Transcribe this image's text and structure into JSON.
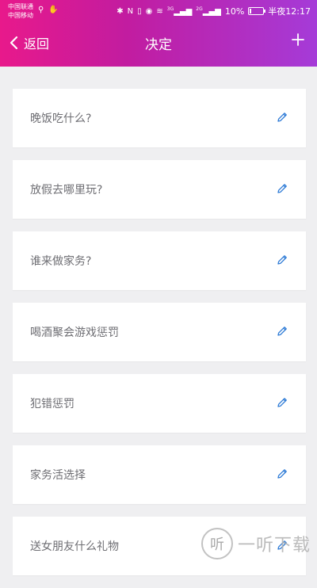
{
  "status_bar": {
    "carrier_1": "中国联通",
    "carrier_2": "中国移动",
    "battery_text": "10%",
    "battery_level": 0.1,
    "time": "半夜12:17",
    "net_3g": "3G",
    "net_2g": "2G"
  },
  "nav": {
    "back_label": "返回",
    "title": "决定"
  },
  "decisions": [
    {
      "label": "晚饭吃什么?"
    },
    {
      "label": "放假去哪里玩?"
    },
    {
      "label": "谁来做家务?"
    },
    {
      "label": "喝酒聚会游戏惩罚"
    },
    {
      "label": "犯错惩罚"
    },
    {
      "label": "家务活选择"
    },
    {
      "label": "送女朋友什么礼物"
    }
  ],
  "watermark": {
    "logo_char": "听",
    "text": "一听下载"
  },
  "colors": {
    "header_start": "#e8198b",
    "header_end": "#a53bd8",
    "edit_icon": "#2e7bd6",
    "background": "#efeff1"
  }
}
